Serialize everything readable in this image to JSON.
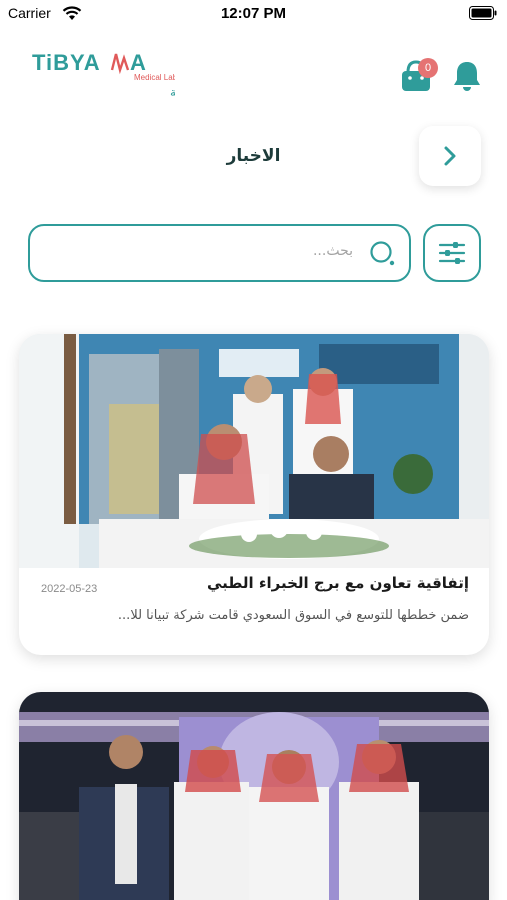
{
  "status_bar": {
    "carrier": "Carrier",
    "time": "12:07 PM"
  },
  "header": {
    "logo": {
      "brand": "TiBYANA",
      "subtitle_en": "Medical Labs",
      "subtitle_ar": "مختبرات تبيانا الطبية"
    },
    "cart_badge_count": "0"
  },
  "page": {
    "title": "الاخبار"
  },
  "search": {
    "placeholder": "بحث..."
  },
  "news": [
    {
      "date": "2022-05-23",
      "title": "إتفاقية تعاون مع برج الخبراء الطبي",
      "excerpt": "ضمن خططها للتوسع في السوق السعودي قامت شركة تبيانا للا..."
    },
    {
      "date": "",
      "title": "",
      "excerpt": ""
    }
  ],
  "colors": {
    "accent": "#2f9c9a",
    "badge": "#e57373",
    "title_text": "#1d3b3a"
  }
}
